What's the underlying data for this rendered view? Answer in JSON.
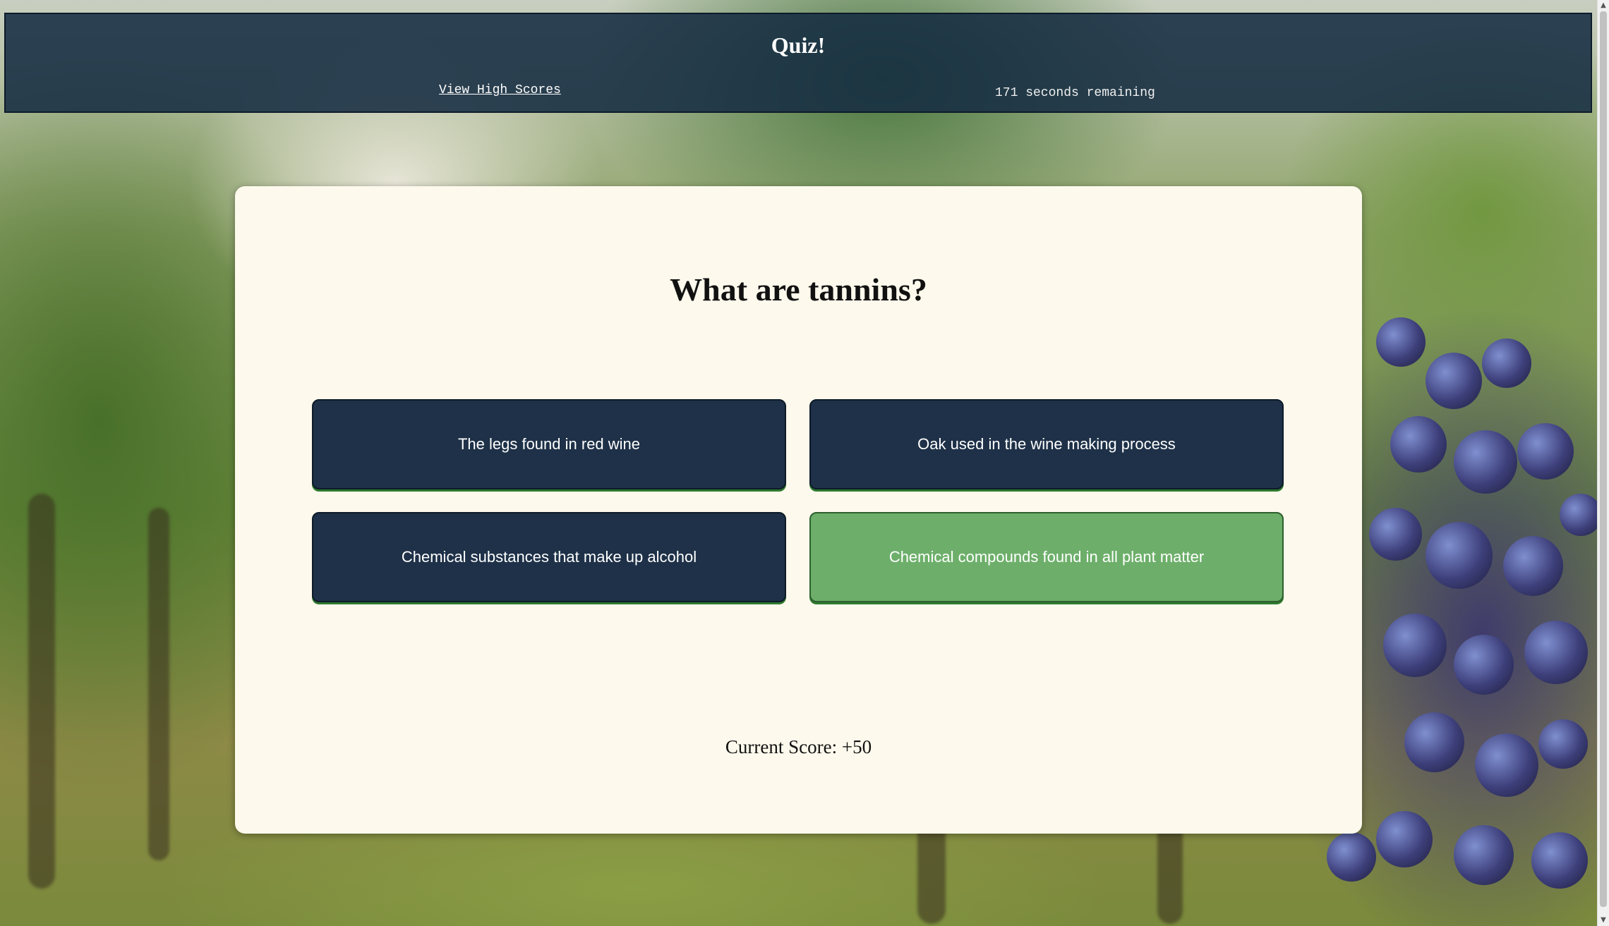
{
  "header": {
    "title": "Quiz!",
    "high_scores_link": "View High Scores",
    "timer_text": "171 seconds remaining"
  },
  "quiz": {
    "question": "What are tannins?",
    "answers": [
      {
        "label": "The legs found in red wine",
        "state": "default"
      },
      {
        "label": "Oak used in the wine making process",
        "state": "default"
      },
      {
        "label": "Chemical substances that make up alcohol",
        "state": "default"
      },
      {
        "label": "Chemical compounds found in all plant matter",
        "state": "correct"
      }
    ],
    "score_text": "Current Score: +50"
  },
  "colors": {
    "header_bg": "#162c42",
    "answer_bg": "#1e3148",
    "correct_bg": "#6daf6a",
    "card_bg": "#fdf9ec"
  },
  "background": {
    "image_icon": "vineyard-grapes-image"
  }
}
